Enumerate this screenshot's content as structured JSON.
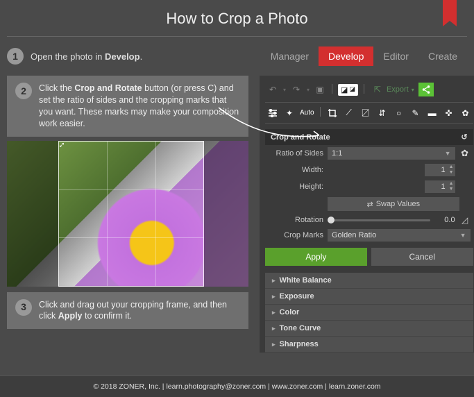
{
  "title": "How to Crop a Photo",
  "step1": {
    "num": "1",
    "html": "Open the photo in <strong>Develop</strong>."
  },
  "tabs": [
    "Manager",
    "Develop",
    "Editor",
    "Create"
  ],
  "activeTab": 1,
  "step2": {
    "num": "2",
    "html": "Click the <strong>Crop and Rotate</strong> button (or press C) and set the ratio of sides and the cropping marks that you want. These marks may make your composition work easier."
  },
  "toolbar2": {
    "auto": "Auto"
  },
  "export": "Export",
  "panel": {
    "title": "Crop and Rotate",
    "ratio_label": "Ratio of Sides",
    "ratio_value": "1:1",
    "width_label": "Width:",
    "width_value": "1",
    "height_label": "Height:",
    "height_value": "1",
    "swap": "Swap Values",
    "rotation_label": "Rotation",
    "rotation_value": "0.0",
    "cropmarks_label": "Crop Marks",
    "cropmarks_value": "Golden Ratio",
    "apply": "Apply",
    "cancel": "Cancel"
  },
  "accordion": [
    "White Balance",
    "Exposure",
    "Color",
    "Tone Curve",
    "Sharpness"
  ],
  "step3": {
    "num": "3",
    "html": "Click and drag out your cropping frame, and then click <strong>Apply</strong> to confirm it."
  },
  "footer": "© 2018 ZONER, Inc.  |  learn.photography@zoner.com  |  www.zoner.com  |  learn.zoner.com"
}
